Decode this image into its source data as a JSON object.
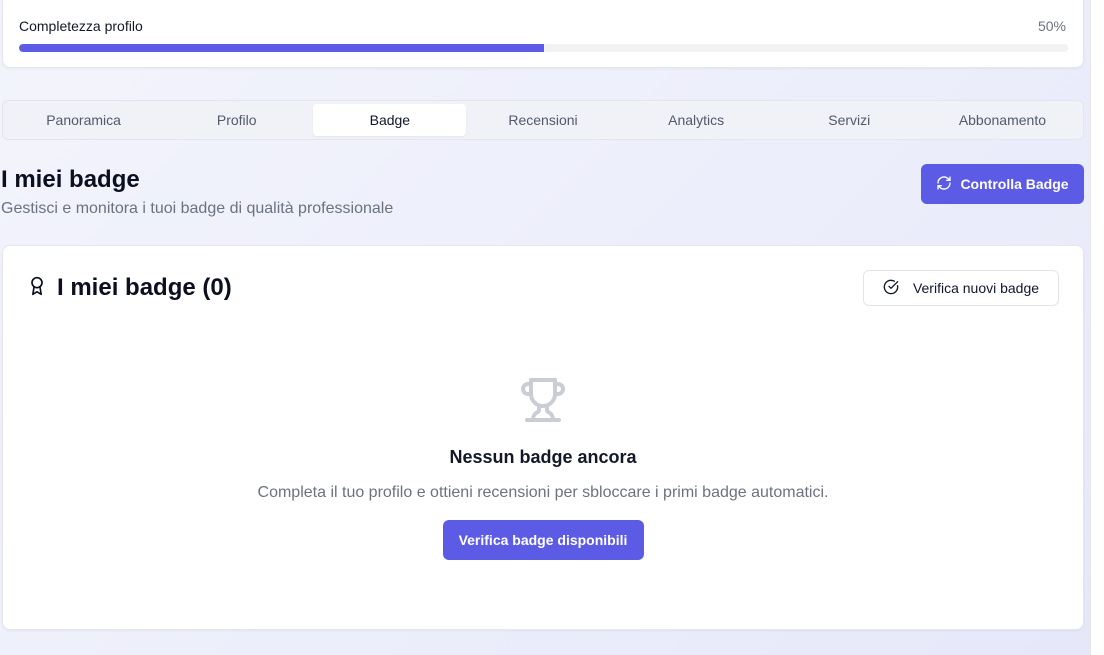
{
  "progress": {
    "label": "Completezza profilo",
    "percent_text": "50%",
    "value": 0.5
  },
  "tabs": [
    {
      "label": "Panoramica",
      "active": false
    },
    {
      "label": "Profilo",
      "active": false
    },
    {
      "label": "Badge",
      "active": true
    },
    {
      "label": "Recensioni",
      "active": false
    },
    {
      "label": "Analytics",
      "active": false
    },
    {
      "label": "Servizi",
      "active": false
    },
    {
      "label": "Abbonamento",
      "active": false
    }
  ],
  "section": {
    "title": "I miei badge",
    "subtitle": "Gestisci e monitora i tuoi badge di qualità professionale",
    "check_button": "Controlla Badge",
    "check_icon": "refresh-icon"
  },
  "card": {
    "title": "I miei badge (0)",
    "title_icon": "award-icon",
    "verify_button": "Verifica nuovi badge",
    "verify_icon": "circle-check-icon"
  },
  "empty": {
    "icon": "trophy-icon",
    "title": "Nessun badge ancora",
    "text": "Completa il tuo profilo e ottieni recensioni per sbloccare i primi badge automatici.",
    "button": "Verifica badge disponibili"
  },
  "colors": {
    "accent": "#5b5be6",
    "muted_text": "#6b7280",
    "icon_muted": "#c9cdd4"
  }
}
